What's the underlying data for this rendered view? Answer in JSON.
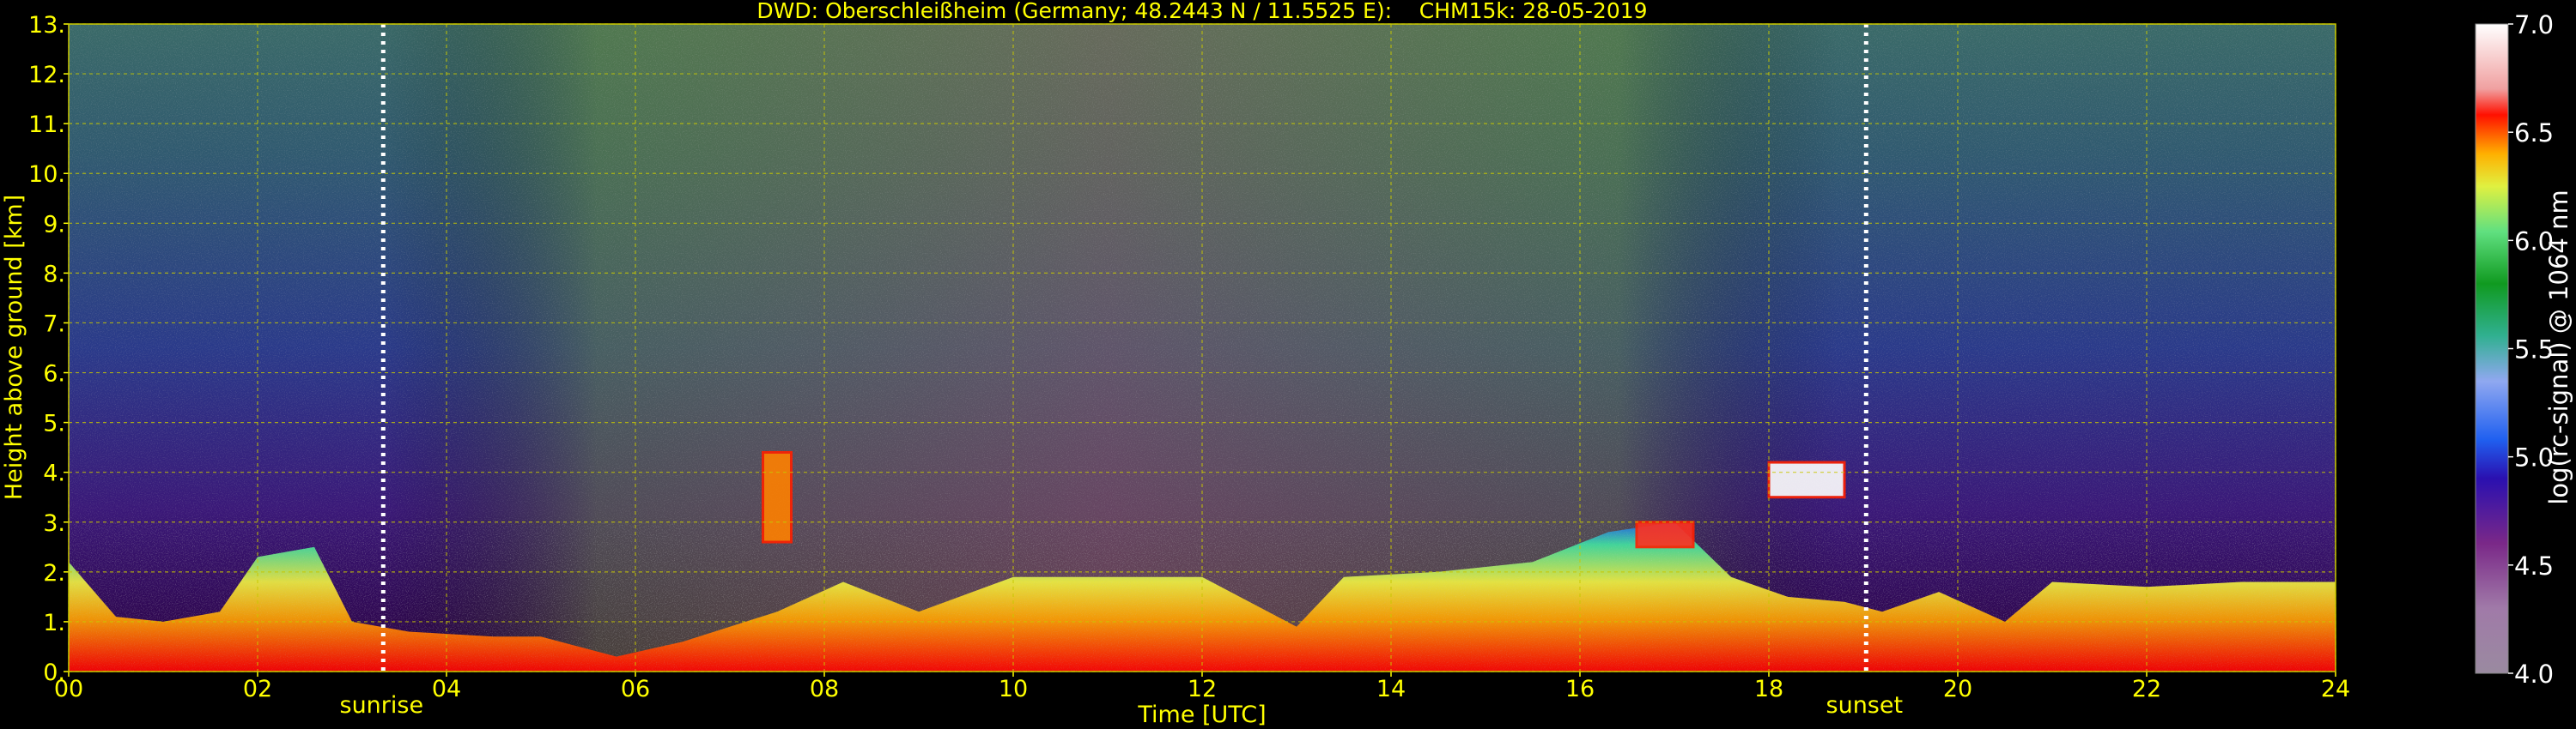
{
  "chart_data": {
    "type": "heatmap",
    "title": "DWD: Oberschleißheim (Germany; 48.2443 N / 11.5525 E):    CHM15k: 28-05-2019",
    "xlabel": "Time [UTC]",
    "ylabel": "Height above ground [km]",
    "xlim": [
      0,
      24
    ],
    "ylim": [
      0,
      13
    ],
    "x_ticks": [
      0,
      2,
      4,
      6,
      8,
      10,
      12,
      14,
      16,
      18,
      20,
      22,
      24
    ],
    "x_tick_labels": [
      "00",
      "02",
      "04",
      "06",
      "08",
      "10",
      "12",
      "14",
      "16",
      "18",
      "20",
      "22",
      "24"
    ],
    "y_ticks": [
      0,
      1,
      2,
      3,
      4,
      5,
      6,
      7,
      8,
      9,
      10,
      11,
      12,
      13
    ],
    "y_tick_labels": [
      "0.",
      "1.",
      "2.",
      "3.",
      "4.",
      "5.",
      "6.",
      "7.",
      "8.",
      "9.",
      "10.",
      "11.",
      "12.",
      "13."
    ],
    "grid": true,
    "markers": [
      {
        "label": "sunrise",
        "time": 3.33
      },
      {
        "label": "sunset",
        "time": 19.03
      }
    ],
    "colorbar": {
      "label": "log(rc-signal) @ 1064 nm",
      "range": [
        4.0,
        7.0
      ],
      "ticks": [
        4.0,
        4.5,
        5.0,
        5.5,
        6.0,
        6.5,
        7.0
      ],
      "tick_labels": [
        "4.0",
        "4.5",
        "5.0",
        "5.5",
        "6.0",
        "6.5",
        "7.0"
      ]
    },
    "aerosol_layer_top_km": [
      [
        0.0,
        2.2
      ],
      [
        0.5,
        1.1
      ],
      [
        1.0,
        1.0
      ],
      [
        1.6,
        1.2
      ],
      [
        2.0,
        2.3
      ],
      [
        2.6,
        2.5
      ],
      [
        3.0,
        1.0
      ],
      [
        3.6,
        0.8
      ],
      [
        4.5,
        0.7
      ],
      [
        5.0,
        0.7
      ],
      [
        5.8,
        0.3
      ],
      [
        6.5,
        0.6
      ],
      [
        7.5,
        1.2
      ],
      [
        8.2,
        1.8
      ],
      [
        9.0,
        1.2
      ],
      [
        10.0,
        1.9
      ],
      [
        11.0,
        1.9
      ],
      [
        12.0,
        1.9
      ],
      [
        13.0,
        0.9
      ],
      [
        13.5,
        1.9
      ],
      [
        14.5,
        2.0
      ],
      [
        15.5,
        2.2
      ],
      [
        16.3,
        2.8
      ],
      [
        17.0,
        3.0
      ],
      [
        17.6,
        1.9
      ],
      [
        18.2,
        1.5
      ],
      [
        18.8,
        1.4
      ],
      [
        19.2,
        1.2
      ],
      [
        19.8,
        1.6
      ],
      [
        20.5,
        1.0
      ],
      [
        21.0,
        1.8
      ],
      [
        22.0,
        1.7
      ],
      [
        23.0,
        1.8
      ],
      [
        24.0,
        1.8
      ]
    ],
    "cloud_patches": [
      {
        "t0": 7.35,
        "t1": 7.65,
        "z0": 2.6,
        "z1": 4.4,
        "value": 6.5
      },
      {
        "t0": 18.0,
        "t1": 18.8,
        "z0": 3.5,
        "z1": 4.2,
        "value": 7.0
      },
      {
        "t0": 16.6,
        "t1": 17.2,
        "z0": 2.5,
        "z1": 3.0,
        "value": 6.8
      }
    ]
  }
}
